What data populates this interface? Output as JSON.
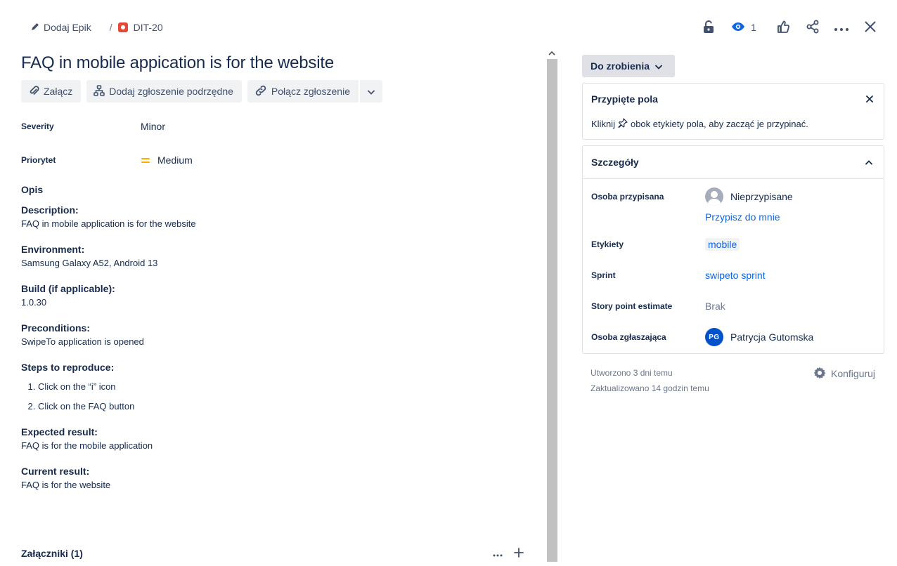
{
  "breadcrumb": {
    "epic_label": "Dodaj Epik",
    "separator": "/",
    "issue_key": "DIT-20"
  },
  "top_actions": {
    "watch_count": "1",
    "icons": [
      "lock-open-icon",
      "eye-icon",
      "thumbs-up-icon",
      "share-icon",
      "more-icon",
      "close-icon"
    ]
  },
  "issue": {
    "title": "FAQ in mobile appication is for the website"
  },
  "toolbar": {
    "attach_label": "Załącz",
    "add_child_label": "Dodaj zgłoszenie podrzędne",
    "link_label": "Połącz zgłoszenie"
  },
  "fields": {
    "severity_label": "Severity",
    "severity_value": "Minor",
    "priority_label": "Priorytet",
    "priority_value": "Medium",
    "priority_color": "#ffab00"
  },
  "description": {
    "heading": "Opis",
    "description_title": "Description:",
    "description_text": "FAQ in mobile application is for the website",
    "environment_title": "Environment:",
    "environment_text": "Samsung Galaxy A52, Android 13",
    "build_title": "Build (if applicable):",
    "build_text": "1.0.30",
    "preconditions_title": "Preconditions:",
    "preconditions_text": "SwipeTo application is opened",
    "steps_title": "Steps to reproduce:",
    "steps": [
      "Click on the “i” icon",
      "Click on the FAQ button"
    ],
    "expected_title": "Expected result:",
    "expected_text": "FAQ is for the mobile application",
    "current_title": "Current result:",
    "current_text": "FAQ is for the website"
  },
  "attachments": {
    "title": "Załączniki (1)"
  },
  "status": {
    "label": "Do zrobienia"
  },
  "pinned": {
    "title": "Przypięte pola",
    "text_before": "Kliknij",
    "text_after": "obok etykiety pola, aby zacząć je przypinać."
  },
  "details": {
    "title": "Szczegóły",
    "assignee_label": "Osoba przypisana",
    "assignee_value": "Nieprzypisane",
    "assign_to_me": "Przypisz do mnie",
    "labels_label": "Etykiety",
    "labels_value": "mobile",
    "sprint_label": "Sprint",
    "sprint_value": "swipeto sprint",
    "story_points_label": "Story point estimate",
    "story_points_value": "Brak",
    "reporter_label": "Osoba zgłaszająca",
    "reporter_initials": "PG",
    "reporter_name": "Patrycja Gutomska"
  },
  "meta": {
    "created": "Utworzono 3 dni temu",
    "updated": "Zaktualizowano 14 godzin temu",
    "configure_label": "Konfiguruj"
  },
  "colors": {
    "link": "#0c66e4",
    "bug": "#e5493a",
    "avatar": "#0052cc"
  }
}
